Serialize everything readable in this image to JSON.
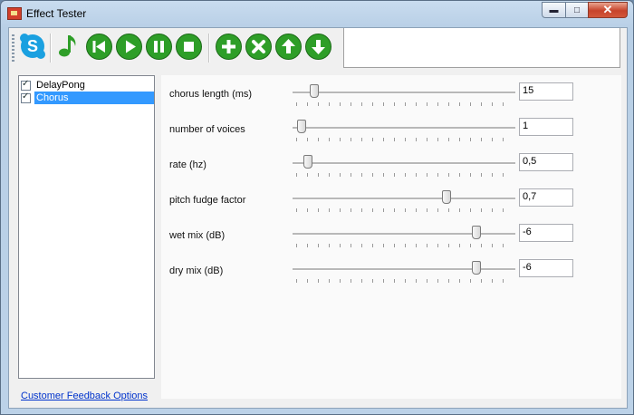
{
  "window": {
    "title": "Effect Tester",
    "close_glyph": "✕",
    "min_glyph": "▬",
    "max_glyph": "□"
  },
  "toolbar": {
    "buttons": [
      {
        "icon": "skype-icon",
        "color": "#1aa0e0"
      },
      {
        "icon": "music-note-icon",
        "color": "#2e9e28"
      },
      {
        "icon": "rewind-icon",
        "color": "#2e9e28"
      },
      {
        "icon": "play-icon",
        "color": "#2e9e28"
      },
      {
        "icon": "pause-icon",
        "color": "#2e9e28"
      },
      {
        "icon": "stop-icon",
        "color": "#2e9e28"
      },
      {
        "icon": "add-icon",
        "color": "#2e9e28"
      },
      {
        "icon": "remove-icon",
        "color": "#2e9e28"
      },
      {
        "icon": "move-up-icon",
        "color": "#2e9e28"
      },
      {
        "icon": "move-down-icon",
        "color": "#2e9e28"
      }
    ]
  },
  "effects": [
    {
      "label": "DelayPong",
      "checked": true,
      "selected": false
    },
    {
      "label": "Chorus",
      "checked": true,
      "selected": true
    }
  ],
  "feedback_link": "Customer Feedback Options",
  "params": [
    {
      "label": "chorus length (ms)",
      "value": "15",
      "level": 0.08
    },
    {
      "label": "number of voices",
      "value": "1",
      "level": 0.02
    },
    {
      "label": "rate (hz)",
      "value": "0,5",
      "level": 0.05
    },
    {
      "label": "pitch fudge factor",
      "value": "0,7",
      "level": 0.7
    },
    {
      "label": "wet mix (dB)",
      "value": "-6",
      "level": 0.84
    },
    {
      "label": "dry mix (dB)",
      "value": "-6",
      "level": 0.84
    }
  ],
  "colors": {
    "selection": "#3399ff",
    "accent_green": "#2e9e28",
    "link": "#0033cc"
  }
}
